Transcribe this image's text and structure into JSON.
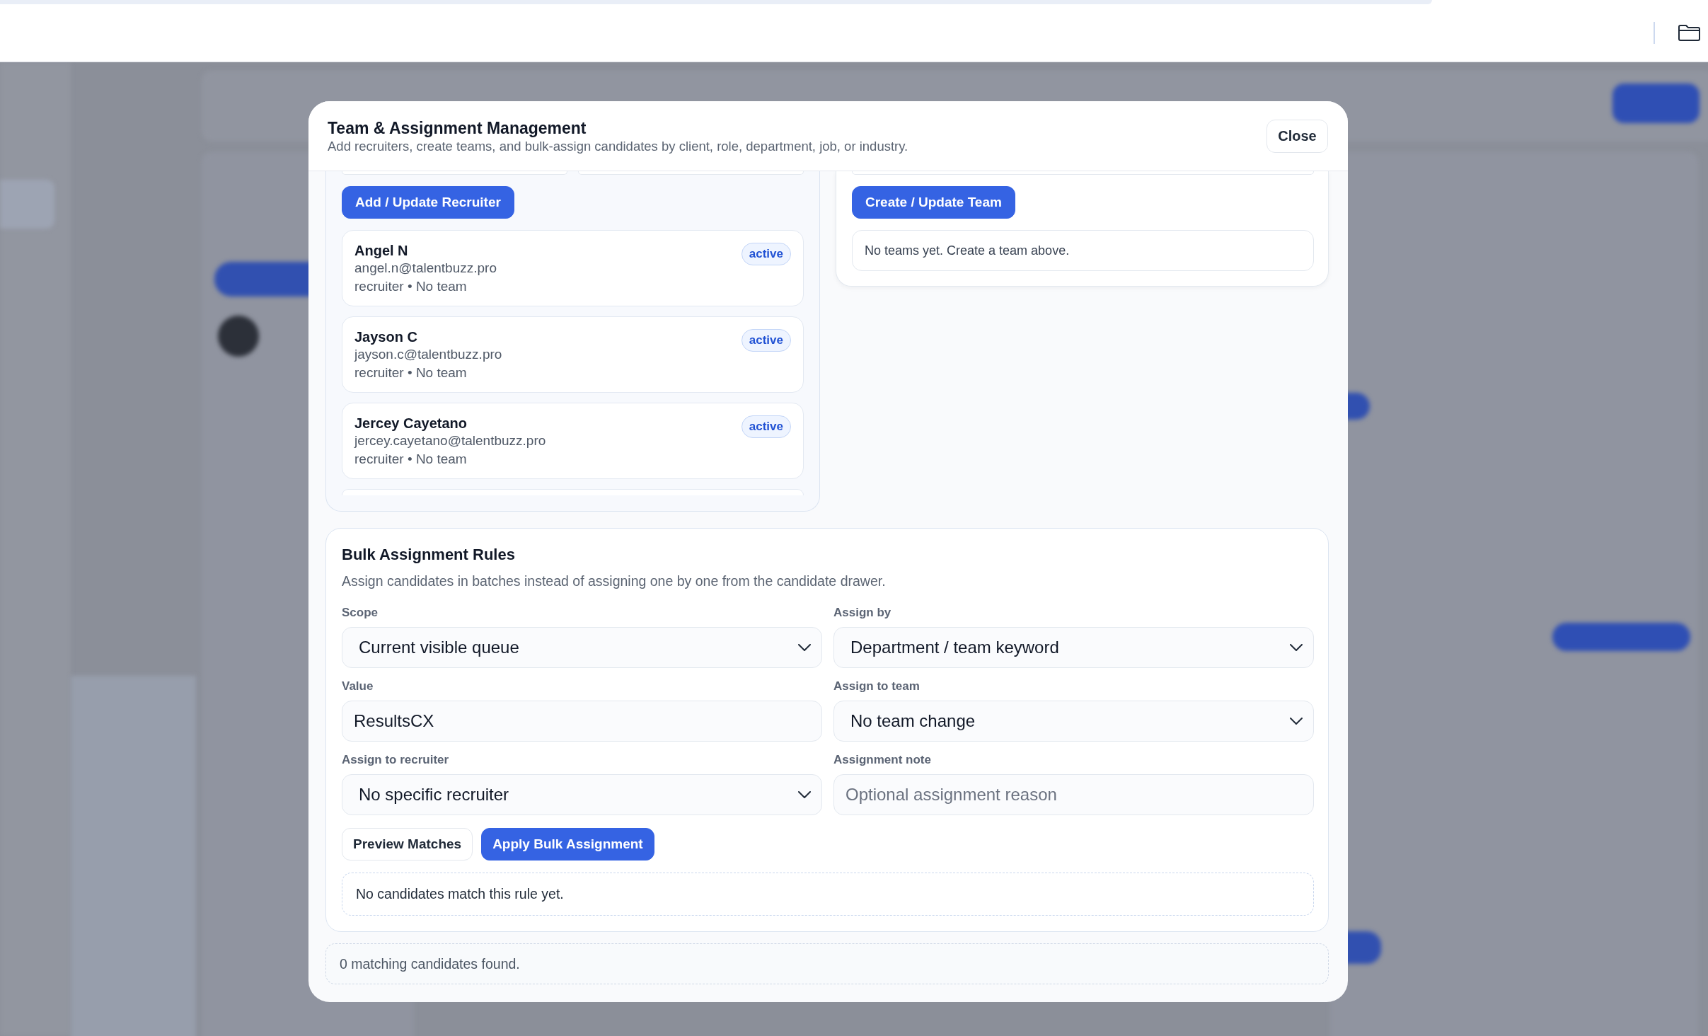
{
  "dialog": {
    "title": "Team & Assignment Management",
    "subtitle": "Add recruiters, create teams, and bulk-assign candidates by client, role, department, job, or industry.",
    "close_button": "Close"
  },
  "recruiters_panel": {
    "button": "Add / Update Recruiter",
    "recruiters": [
      {
        "name": "Angel N",
        "email": "angel.n@talentbuzz.pro",
        "details": "recruiter • No team",
        "status": "active"
      },
      {
        "name": "Jayson C",
        "email": "jayson.c@talentbuzz.pro",
        "details": "recruiter • No team",
        "status": "active"
      },
      {
        "name": "Jercey Cayetano",
        "email": "jercey.cayetano@talentbuzz.pro",
        "details": "recruiter • No team",
        "status": "active"
      }
    ]
  },
  "teams_panel": {
    "button": "Create / Update Team",
    "empty_message": "No teams yet. Create a team above."
  },
  "bulk_rules": {
    "title": "Bulk Assignment Rules",
    "description": "Assign candidates in batches instead of assigning one by one from the candidate drawer.",
    "fields": [
      {
        "label": "Scope",
        "kind": "select",
        "value": "Current visible queue"
      },
      {
        "label": "Assign by",
        "kind": "select",
        "value": "Department / team keyword"
      },
      {
        "label": "Value",
        "kind": "text",
        "value": "ResultsCX"
      },
      {
        "label": "Assign to team",
        "kind": "select",
        "value": "No team change"
      },
      {
        "label": "Assign to recruiter",
        "kind": "select",
        "value": "No specific recruiter"
      },
      {
        "label": "Assignment note",
        "kind": "text",
        "placeholder": "Optional assignment reason"
      }
    ],
    "buttons": [
      {
        "label": "Preview Matches",
        "kind": "secondary"
      },
      {
        "label": "Apply Bulk Assignment",
        "kind": "primary"
      }
    ],
    "result_message": "No candidates match this rule yet."
  },
  "status_message": "0 matching candidates found."
}
